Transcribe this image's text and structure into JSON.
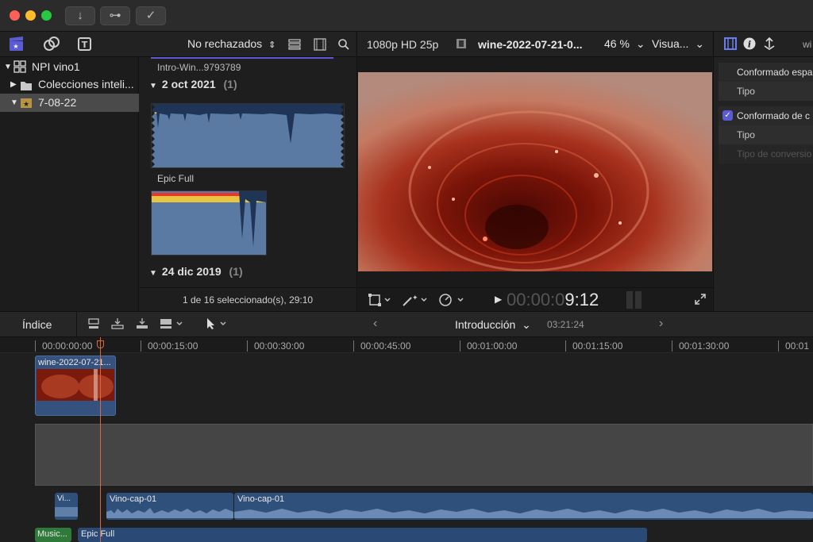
{
  "toolbar": {
    "import_icon": "download-arrow-icon",
    "keyword_icon": "key-icon",
    "check_icon": "checkmark-circle-icon",
    "import_glyph": "↓",
    "keyword_glyph": "⊶",
    "check_glyph": "✓"
  },
  "library": {
    "filter_label": "No rechazados",
    "filter_chevron": "⌃"
  },
  "sidebar": {
    "items": [
      {
        "label": "NPI vino1",
        "expand": "▼",
        "icon": "library-icon"
      },
      {
        "label": "Colecciones inteli...",
        "expand": "▶",
        "icon": "folder-icon"
      },
      {
        "label": "7-08-22",
        "expand": "▼",
        "icon": "event-icon"
      }
    ]
  },
  "browser": {
    "top_clip": "Intro-Win...9793789",
    "groups": [
      {
        "date": "2 oct 2021",
        "count": "(1)"
      },
      {
        "date": "24 dic 2019",
        "count": "(1)"
      }
    ],
    "clip_label": "Epic Full",
    "status": "1 de 16 seleccionado(s), 29:10"
  },
  "viewer": {
    "format": "1080p HD 25p",
    "clip_name": "wine-2022-07-21-0...",
    "zoom": "46 %",
    "zoom_chevron": "⌄",
    "view_label": "Visua...",
    "view_chevron": "⌄",
    "timecode_dim": "00:00:0",
    "timecode_bright": "9:12"
  },
  "inspector": {
    "tab_right": "wi",
    "rows": [
      {
        "label": "Conformado espa",
        "checked": false
      },
      {
        "label": "Tipo",
        "checked": false
      },
      {
        "label": "Conformado de c",
        "checked": true
      },
      {
        "label": "Tipo",
        "checked": false
      },
      {
        "label": "Tipo de conversio",
        "checked": false
      }
    ]
  },
  "timeline_bar": {
    "index_label": "Índice",
    "project": "Introducción",
    "project_chevron": "⌄",
    "duration": "03:21:24",
    "prev": "‹",
    "next": "›"
  },
  "ruler": [
    "00:00:00:00",
    "00:00:15:00",
    "00:00:30:00",
    "00:00:45:00",
    "00:01:00:00",
    "00:01:15:00",
    "00:01:30:00",
    "00:01"
  ],
  "clips": {
    "video": "wine-2022-07-21...",
    "audio1": "Vi...",
    "audio2": "Vino-cap-01",
    "audio3": "Vino-cap-01",
    "music1": "Music...",
    "music2": "Epic Full"
  },
  "colors": {
    "accent": "#5b5bd6",
    "playhead": "#e0663a",
    "clip_blue": "#3e5e8a",
    "audio_green": "#2f7a3b"
  }
}
